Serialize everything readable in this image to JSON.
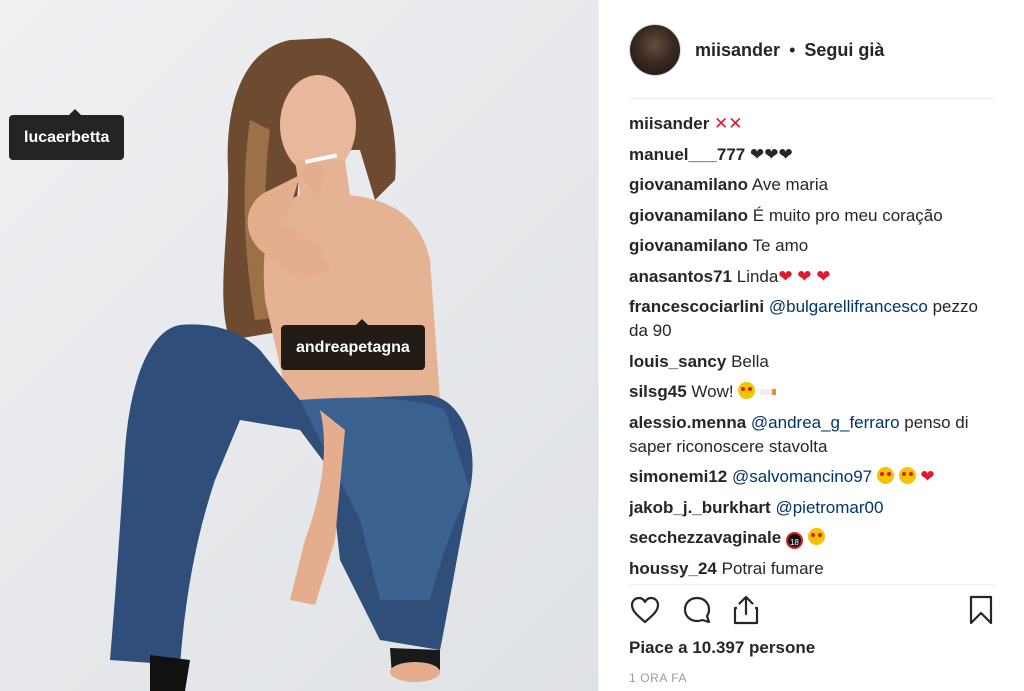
{
  "photo": {
    "tags": [
      {
        "label": "lucaerbetta"
      },
      {
        "label": "andreapetagna"
      }
    ]
  },
  "header": {
    "username": "miisander",
    "separator": "•",
    "follow_status": "Segui già"
  },
  "comments": [
    {
      "user": "miisander",
      "parts": [
        {
          "t": "x",
          "v": "✕✕"
        }
      ]
    },
    {
      "user": "manuel___777",
      "parts": [
        {
          "t": "bh",
          "v": "❤❤❤"
        }
      ]
    },
    {
      "user": "giovanamilano",
      "parts": [
        {
          "t": "text",
          "v": "Ave maria"
        }
      ]
    },
    {
      "user": "giovanamilano",
      "parts": [
        {
          "t": "text",
          "v": "É muito pro meu coração"
        }
      ]
    },
    {
      "user": "giovanamilano",
      "parts": [
        {
          "t": "text",
          "v": "Te amo"
        }
      ]
    },
    {
      "user": "anasantos71",
      "parts": [
        {
          "t": "text",
          "v": "Linda"
        },
        {
          "t": "heart",
          "v": "❤ ❤ ❤"
        }
      ]
    },
    {
      "user": "francescociarlini",
      "parts": [
        {
          "t": "mention",
          "v": "@bulgarellifrancesco"
        },
        {
          "t": "text",
          "v": " pezzo da 90"
        }
      ]
    },
    {
      "user": "louis_sancy",
      "parts": [
        {
          "t": "text",
          "v": "Bella"
        }
      ]
    },
    {
      "user": "silsg45",
      "parts": [
        {
          "t": "text",
          "v": "Wow! "
        },
        {
          "t": "face",
          "v": ""
        },
        {
          "t": "text",
          "v": " "
        },
        {
          "t": "cig",
          "v": ""
        }
      ]
    },
    {
      "user": "alessio.menna",
      "parts": [
        {
          "t": "mention",
          "v": "@andrea_g_ferraro"
        },
        {
          "t": "text",
          "v": " penso di saper riconoscere stavolta"
        }
      ]
    },
    {
      "user": "simonemi12",
      "parts": [
        {
          "t": "mention",
          "v": "@salvomancino97"
        },
        {
          "t": "text",
          "v": " "
        },
        {
          "t": "face",
          "v": ""
        },
        {
          "t": "text",
          "v": " "
        },
        {
          "t": "face",
          "v": ""
        },
        {
          "t": "text",
          "v": " "
        },
        {
          "t": "heart",
          "v": "❤"
        }
      ]
    },
    {
      "user": "jakob_j._burkhart",
      "parts": [
        {
          "t": "mention",
          "v": "@pietromar00"
        }
      ]
    },
    {
      "user": "secchezzavaginale",
      "parts": [
        {
          "t": "e18",
          "v": "18"
        },
        {
          "t": "text",
          "v": " "
        },
        {
          "t": "face",
          "v": ""
        }
      ]
    },
    {
      "user": "houssy_24",
      "parts": [
        {
          "t": "text",
          "v": "Potrai fumare"
        }
      ]
    }
  ],
  "actions": {
    "like_icon": "heart-outline-icon",
    "comment_icon": "comment-bubble-icon",
    "share_icon": "share-upload-icon",
    "save_icon": "bookmark-icon"
  },
  "likes_text": "Piace a 10.397 persone",
  "timestamp": "1 ORA FA",
  "colors": {
    "mention": "#003569",
    "heart": "#e0192c",
    "tag_bg": "#000000"
  }
}
